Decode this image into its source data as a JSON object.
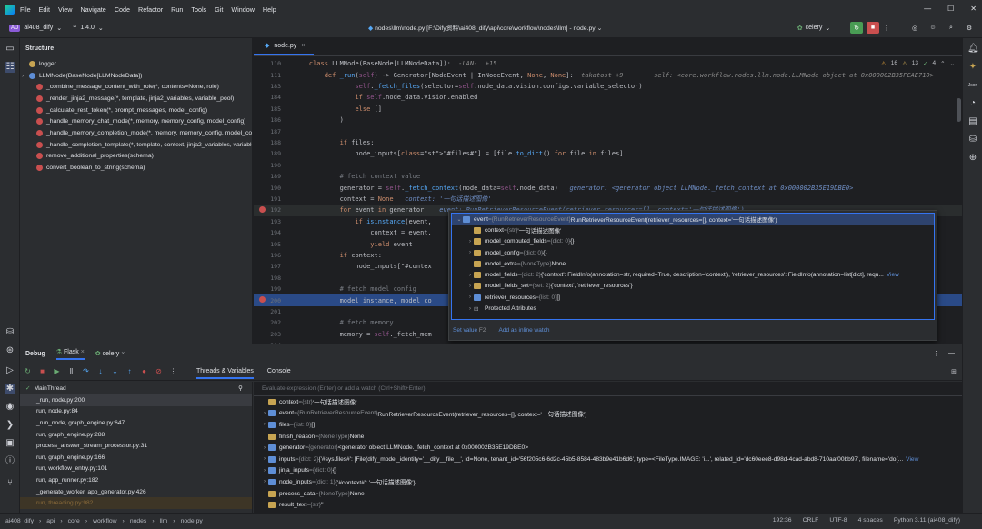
{
  "menu": [
    "File",
    "Edit",
    "View",
    "Navigate",
    "Code",
    "Refactor",
    "Run",
    "Tools",
    "Git",
    "Window",
    "Help"
  ],
  "toolbar": {
    "project_badge": "AD",
    "project_name": "ai408_dify",
    "version": "1.4.0",
    "file_path": "nodes\\llm\\node.py [F:\\Dify资料\\ai408_dify\\api\\core\\workflow\\nodes\\llm] - node.py",
    "run_config": "celery"
  },
  "structure": {
    "title": "Structure",
    "items": [
      {
        "label": "logger",
        "kind": "var"
      },
      {
        "label": "LLMNode(BaseNode[LLMNodeData])",
        "kind": "class"
      },
      {
        "label": "_combine_message_content_with_role(*, contents=None, role)",
        "kind": "method"
      },
      {
        "label": "_render_jinja2_message(*, template, jinja2_variables, variable_pool)",
        "kind": "method"
      },
      {
        "label": "_calculate_rest_token(*, prompt_messages, model_config)",
        "kind": "method"
      },
      {
        "label": "_handle_memory_chat_mode(*, memory, memory_config, model_config)",
        "kind": "method"
      },
      {
        "label": "_handle_memory_completion_mode(*, memory, memory_config, model_config)",
        "kind": "method"
      },
      {
        "label": "_handle_completion_template(*, template, context, jinja2_variables, variable_pool)",
        "kind": "method"
      },
      {
        "label": "remove_additional_properties(schema)",
        "kind": "method"
      },
      {
        "label": "convert_boolean_to_string(schema)",
        "kind": "method"
      }
    ]
  },
  "editor": {
    "tab": "node.py",
    "inspections": {
      "warnings": "16",
      "weak": "13",
      "typos": "4"
    },
    "lines": [
      {
        "n": "110",
        "t": "    class LLMNode(BaseNode[LLMNodeData]):  ",
        "hint": "-LAN-  +15"
      },
      {
        "n": "111",
        "t": "        def _run(self) -> Generator[NodeEvent | InNodeEvent, None, None]:",
        "hint": "  takatost +9        self: <core.workflow.nodes.llm.node.LLMNode object at 0x000002B35FCAE710>"
      },
      {
        "n": "183",
        "t": "                self._fetch_files(selector=self.node_data.vision.configs.variable_selector)",
        "hint": ""
      },
      {
        "n": "184",
        "t": "                if self.node_data.vision.enabled",
        "hint": ""
      },
      {
        "n": "185",
        "t": "                else []",
        "hint": ""
      },
      {
        "n": "186",
        "t": "            )",
        "hint": ""
      },
      {
        "n": "187",
        "t": "",
        "hint": ""
      },
      {
        "n": "188",
        "t": "            if files:",
        "hint": ""
      },
      {
        "n": "189",
        "t": "                node_inputs[\"#files#\"] = [file.to_dict() for file in files]",
        "hint": ""
      },
      {
        "n": "190",
        "t": "",
        "hint": ""
      },
      {
        "n": "189",
        "t": "            # fetch context value",
        "hint": ""
      },
      {
        "n": "190",
        "t": "            generator = self._fetch_context(node_data=self.node_data)",
        "hint": "   generator: <generator object LLMNode._fetch_context at 0x000002B35E19DBE0>"
      },
      {
        "n": "191",
        "t": "            context = None",
        "hint": "   context: '一句话描述图像'"
      },
      {
        "n": "192",
        "t": "            for event in generator:",
        "hint": "   event: RunRetrieverResourceEvent(retriever_resources=[], context='一句话描述图像') ⌄"
      },
      {
        "n": "193",
        "t": "                if isinstance(event,",
        "hint": ""
      },
      {
        "n": "194",
        "t": "                    context = event.",
        "hint": ""
      },
      {
        "n": "195",
        "t": "                    yield event",
        "hint": ""
      },
      {
        "n": "196",
        "t": "            if context:",
        "hint": ""
      },
      {
        "n": "197",
        "t": "                node_inputs[\"#contex",
        "hint": ""
      },
      {
        "n": "198",
        "t": "",
        "hint": ""
      },
      {
        "n": "199",
        "t": "            # fetch model config",
        "hint": ""
      },
      {
        "n": "200",
        "t": "            model_instance, model_co",
        "hint": ""
      },
      {
        "n": "201",
        "t": "",
        "hint": ""
      },
      {
        "n": "202",
        "t": "            # fetch memory",
        "hint": ""
      },
      {
        "n": "203",
        "t": "            memory = self._fetch_mem",
        "hint": ""
      },
      {
        "n": "204",
        "t": "",
        "hint": ""
      },
      {
        "n": "205",
        "t": "            query = None",
        "hint": ""
      }
    ]
  },
  "popup": {
    "rows": [
      {
        "indent": 0,
        "expand": "⌄",
        "icon": "blue",
        "name": "event",
        "type": "{RunRetrieverResourceEvent}",
        "value": "RunRetrieverResourceEvent(retriever_resources=[], context='一句话描述图像')",
        "sel": true
      },
      {
        "indent": 1,
        "expand": "",
        "icon": "yellow",
        "name": "context",
        "type": "{str}",
        "value": "'一句话描述图像'"
      },
      {
        "indent": 1,
        "expand": "›",
        "icon": "yellow",
        "name": "model_computed_fields",
        "type": "{dict: 0}",
        "value": "{}"
      },
      {
        "indent": 1,
        "expand": "›",
        "icon": "yellow",
        "name": "model_config",
        "type": "{dict: 0}",
        "value": "{}"
      },
      {
        "indent": 1,
        "expand": "",
        "icon": "yellow",
        "name": "model_extra",
        "type": "{NoneType}",
        "value": "None"
      },
      {
        "indent": 1,
        "expand": "›",
        "icon": "yellow",
        "name": "model_fields",
        "type": "{dict: 2}",
        "value": "{'context': FieldInfo(annotation=str, required=True, description='context'), 'retriever_resources': FieldInfo(annotation=list[dict], requ...",
        "link": "View"
      },
      {
        "indent": 1,
        "expand": "›",
        "icon": "yellow",
        "name": "model_fields_set",
        "type": "{set: 2}",
        "value": "{'context', 'retriever_resources'}"
      },
      {
        "indent": 1,
        "expand": "›",
        "icon": "blue",
        "name": "retriever_resources",
        "type": "{list: 0}",
        "value": "[]"
      },
      {
        "indent": 1,
        "expand": "›",
        "icon": "none",
        "name": "Protected Attributes",
        "type": "",
        "value": ""
      }
    ],
    "set_value": "Set value",
    "set_value_key": "F2",
    "add_watch": "Add as inline watch"
  },
  "debug": {
    "title": "Debug",
    "sessions": [
      "Flask",
      "celery"
    ],
    "tabs": [
      "Threads & Variables",
      "Console"
    ],
    "thread": "MainThread",
    "frames": [
      "_run, node.py:200",
      "run, node.py:84",
      "_run_node, graph_engine.py:647",
      "run, graph_engine.py:288",
      "process_answer_stream_processor.py:31",
      "run, graph_engine.py:166",
      "run, workflow_entry.py:101",
      "run, app_runner.py:182",
      "_generate_worker, app_generator.py:426",
      "run, threading.py:982"
    ],
    "expr_placeholder": "Evaluate expression (Enter) or add a watch (Ctrl+Shift+Enter)",
    "vars": [
      {
        "expand": "",
        "name": "context",
        "type": "{str}",
        "value": "'一句话描述图像'"
      },
      {
        "expand": "›",
        "name": "event",
        "type": "{RunRetrieverResourceEvent}",
        "value": "RunRetrieverResourceEvent(retriever_resources=[], context='一句话描述图像')"
      },
      {
        "expand": "›",
        "name": "files",
        "type": "{list: 0}",
        "value": "[]"
      },
      {
        "expand": "",
        "name": "finish_reason",
        "type": "{NoneType}",
        "value": "None"
      },
      {
        "expand": "›",
        "name": "generator",
        "type": "{generator}",
        "value": "<generator object LLMNode._fetch_context at 0x000002B35E19DBE0>"
      },
      {
        "expand": "›",
        "name": "inputs",
        "type": "{dict: 2}",
        "value": "{'#sys.files#': [File(dify_model_identity='__dify__file__', id=None, tenant_id='56f205c6-6d2c-45b5-8584-483b9e41b6d6', type=<FileType.IMAGE: 'i...', related_id='dc60eee8-d98d-4cad-abd8-710aaf00bb97', filename='do(...",
        "link": "View"
      },
      {
        "expand": "›",
        "name": "jinja_inputs",
        "type": "{dict: 0}",
        "value": "{}"
      },
      {
        "expand": "›",
        "name": "node_inputs",
        "type": "{dict: 1}",
        "value": "{'#context#': '一句话描述图像'}"
      },
      {
        "expand": "",
        "name": "process_data",
        "type": "{NoneType}",
        "value": "None"
      },
      {
        "expand": "",
        "name": "result_text",
        "type": "{str}",
        "value": "''"
      }
    ]
  },
  "status": {
    "crumbs": [
      "ai408_dify",
      "api",
      "core",
      "workflow",
      "nodes",
      "llm",
      "node.py"
    ],
    "position": "192:36",
    "line_sep": "CRLF",
    "encoding": "UTF-8",
    "indent": "4 spaces",
    "interpreter": "Python 3.11 (ai408_dify)"
  }
}
